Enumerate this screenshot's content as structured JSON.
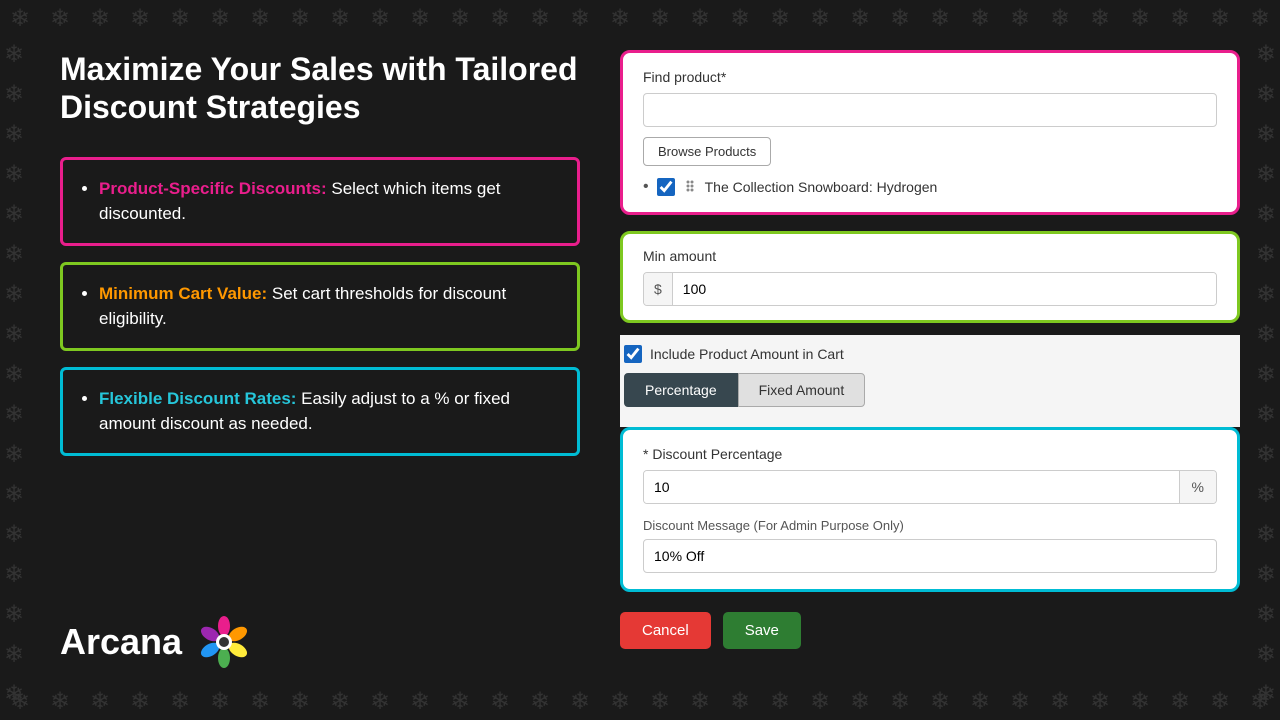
{
  "page": {
    "background": "#1a1a1a"
  },
  "headline": {
    "line1": "Maximize Your Sales with Tailored",
    "line2": "Discount Strategies"
  },
  "features": [
    {
      "label": "Product-Specific Discounts:",
      "text": " Select which items get discounted.",
      "color_class": "pink",
      "label_class": "label-pink"
    },
    {
      "label": "Minimum Cart Value:",
      "text": " Set cart thresholds for discount eligibility.",
      "color_class": "green",
      "label_class": "label-orange"
    },
    {
      "label": "Flexible Discount Rates:",
      "text": " Easily adjust to a %  or fixed amount discount as needed.",
      "color_class": "cyan",
      "label_class": "label-teal"
    }
  ],
  "logo": {
    "text": "Arcana"
  },
  "find_product": {
    "label": "Find product*",
    "browse_btn": "Browse Products",
    "product_name": "The Collection Snowboard: Hydrogen"
  },
  "min_amount": {
    "label": "Min amount",
    "prefix": "$",
    "value": "100",
    "checkbox_label": "Include Product Amount in Cart",
    "toggle_percentage": "Percentage",
    "toggle_fixed": "Fixed Amount"
  },
  "discount": {
    "label": "* Discount Percentage",
    "value": "10",
    "suffix": "%",
    "message_label": "Discount Message (For Admin Purpose Only)",
    "message_value": "10% Off"
  },
  "actions": {
    "cancel": "Cancel",
    "save": "Save"
  }
}
